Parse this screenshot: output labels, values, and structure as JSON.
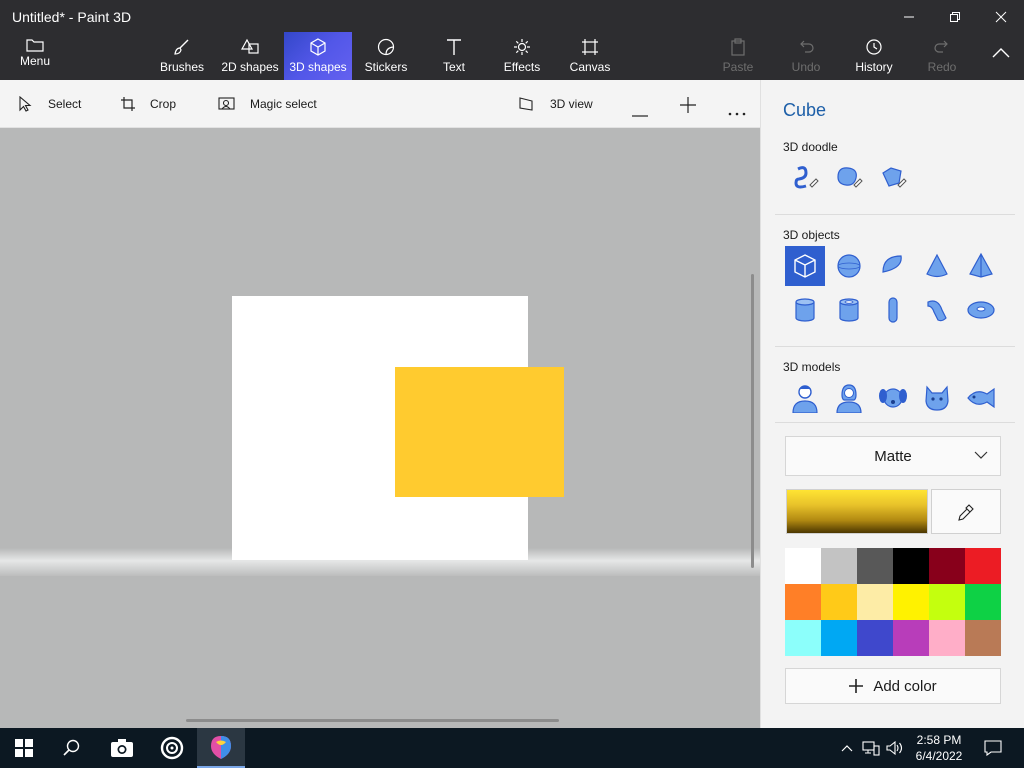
{
  "window": {
    "title": "Untitled* - Paint 3D",
    "controls": [
      "minimize",
      "restore",
      "close"
    ]
  },
  "ribbon": {
    "menu_label": "Menu",
    "tools": [
      {
        "label": "Brushes",
        "icon": "brush-icon"
      },
      {
        "label": "2D shapes",
        "icon": "2d-shapes-icon"
      },
      {
        "label": "3D shapes",
        "icon": "cube-icon",
        "active": true
      },
      {
        "label": "Stickers",
        "icon": "sticker-icon"
      },
      {
        "label": "Text",
        "icon": "text-icon"
      },
      {
        "label": "Effects",
        "icon": "effects-icon"
      },
      {
        "label": "Canvas",
        "icon": "canvas-icon"
      }
    ],
    "actions": [
      {
        "label": "Paste",
        "icon": "paste-icon",
        "enabled": false
      },
      {
        "label": "Undo",
        "icon": "undo-icon",
        "enabled": false
      },
      {
        "label": "History",
        "icon": "history-icon",
        "enabled": true
      },
      {
        "label": "Redo",
        "icon": "redo-icon",
        "enabled": false
      }
    ]
  },
  "toolbar": {
    "select_label": "Select",
    "crop_label": "Crop",
    "magic_select_label": "Magic select",
    "view_3d_label": "3D view"
  },
  "panel": {
    "title": "Cube",
    "doodle_label": "3D doodle",
    "objects_label": "3D objects",
    "models_label": "3D models",
    "material": "Matte",
    "add_color_label": "Add color",
    "current_color": "#ffcb2f",
    "palette": [
      "#ffffff",
      "#c3c3c3",
      "#585858",
      "#000000",
      "#88001b",
      "#ec1c24",
      "#ff7f27",
      "#ffca18",
      "#fdeca6",
      "#fff200",
      "#c4ff0e",
      "#0ed145",
      "#8cfffb",
      "#00a8f3",
      "#3f48cc",
      "#b83dba",
      "#ffaec8",
      "#b97a56"
    ]
  },
  "canvas": {
    "paper_color": "#ffffff",
    "cube_color": "#ffcb2f"
  },
  "taskbar": {
    "time": "2:58 PM",
    "date": "6/4/2022"
  }
}
